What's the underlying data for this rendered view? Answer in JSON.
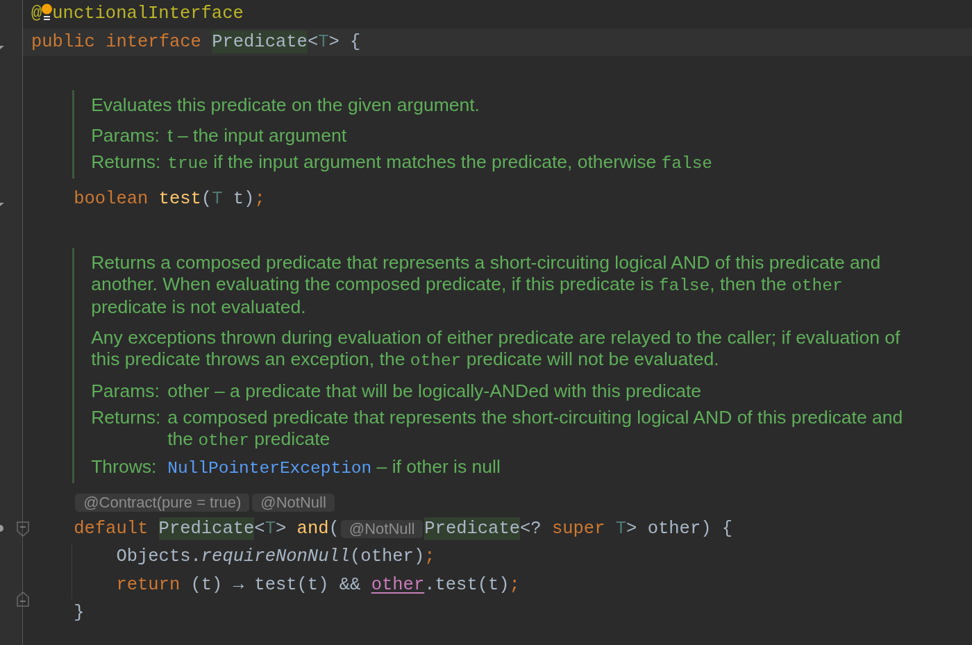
{
  "editor": {
    "lines": [
      {
        "kind": "code",
        "bulb": true,
        "tokens": [
          {
            "text": "@",
            "kind": "annotation"
          },
          {
            "text": "unctionalInterface",
            "kind": "annotation"
          }
        ]
      },
      {
        "kind": "code",
        "current": true,
        "gutter": [
          {
            "kind": "arrow"
          }
        ],
        "tokens": [
          {
            "text": "public ",
            "kind": "keyword"
          },
          {
            "text": "interface ",
            "kind": "keyword"
          },
          {
            "text": "Predicate",
            "kind": "type",
            "highlighted": true
          },
          {
            "text": "<",
            "kind": "type"
          },
          {
            "text": "T",
            "kind": "type-param"
          },
          {
            "text": "> {",
            "kind": "type"
          }
        ],
        "children": [
          {
            "kind": "doc",
            "paragraphs": [
              [
                {
                  "kind": "text",
                  "text": "Evaluates this predicate on the given argument."
                }
              ]
            ],
            "tags": [
              {
                "label": "Params:",
                "segments": [
                  {
                    "kind": "text",
                    "text": "t – the input argument"
                  }
                ]
              },
              {
                "label": "Returns:",
                "segments": [
                  {
                    "kind": "code",
                    "text": "true"
                  },
                  {
                    "kind": "text",
                    "text": " if the input argument matches the predicate, otherwise "
                  },
                  {
                    "kind": "code",
                    "text": "false"
                  }
                ]
              }
            ]
          },
          {
            "kind": "code",
            "gutter": [
              {
                "kind": "arrow"
              }
            ],
            "tokens": [
              {
                "text": "boolean ",
                "kind": "keyword"
              },
              {
                "text": "test",
                "kind": "method"
              },
              {
                "text": "(",
                "kind": "type"
              },
              {
                "text": "T",
                "kind": "type-param"
              },
              {
                "text": " t)",
                "kind": "type"
              },
              {
                "text": ";",
                "kind": "punct"
              }
            ]
          },
          {
            "kind": "doc",
            "paragraphs": [
              [
                {
                  "kind": "text",
                  "text": "Returns a composed predicate that represents a short-circuiting logical AND of this predicate and another. When evaluating the composed predicate, if this predicate is "
                },
                {
                  "kind": "code",
                  "text": "false"
                },
                {
                  "kind": "text",
                  "text": ", then the "
                },
                {
                  "kind": "code",
                  "text": "other"
                },
                {
                  "kind": "text",
                  "text": " predicate is not evaluated."
                }
              ],
              [
                {
                  "kind": "text",
                  "text": "Any exceptions thrown during evaluation of either predicate are relayed to the caller; if evaluation of this predicate throws an exception, the "
                },
                {
                  "kind": "code",
                  "text": "other"
                },
                {
                  "kind": "text",
                  "text": " predicate will not be evaluated."
                }
              ]
            ],
            "tags": [
              {
                "label": "Params:",
                "segments": [
                  {
                    "kind": "text",
                    "text": "other – a predicate that will be logically-ANDed with this predicate"
                  }
                ]
              },
              {
                "label": "Returns:",
                "segments": [
                  {
                    "kind": "text",
                    "text": "a composed predicate that represents the short-circuiting logical AND of this predicate and the "
                  },
                  {
                    "kind": "code",
                    "text": "other"
                  },
                  {
                    "kind": "text",
                    "text": " predicate"
                  }
                ]
              },
              {
                "label": "Throws:",
                "segments": [
                  {
                    "kind": "link",
                    "text": "NullPointerException"
                  },
                  {
                    "kind": "text",
                    "text": " – if other is null"
                  }
                ]
              }
            ]
          },
          {
            "kind": "code",
            "tokens": [
              {
                "text": "@Contract(pure = true)",
                "kind": "hint"
              },
              {
                "text": "@NotNull",
                "kind": "hint"
              }
            ]
          },
          {
            "kind": "code",
            "gutter": [
              {
                "kind": "dot"
              },
              {
                "kind": "fold-start"
              }
            ],
            "tokens": [
              {
                "text": "default ",
                "kind": "keyword"
              },
              {
                "text": "Predicate",
                "kind": "type",
                "highlighted": true
              },
              {
                "text": "<",
                "kind": "type"
              },
              {
                "text": "T",
                "kind": "type-param"
              },
              {
                "text": "> ",
                "kind": "type"
              },
              {
                "text": "and",
                "kind": "method"
              },
              {
                "text": "(",
                "kind": "type"
              },
              {
                "text": "@NotNull",
                "kind": "hint"
              },
              {
                "text": "Predicate",
                "kind": "type",
                "highlighted": true
              },
              {
                "text": "<? ",
                "kind": "type"
              },
              {
                "text": "super ",
                "kind": "keyword"
              },
              {
                "text": "T",
                "kind": "type-param"
              },
              {
                "text": "> other) {",
                "kind": "type"
              }
            ],
            "children": [
              {
                "kind": "code",
                "tokens": [
                  {
                    "text": "Objects.",
                    "kind": "type"
                  },
                  {
                    "text": "requireNonNull",
                    "kind": "static-method"
                  },
                  {
                    "text": "(other)",
                    "kind": "type"
                  },
                  {
                    "text": ";",
                    "kind": "punct"
                  }
                ]
              },
              {
                "kind": "code",
                "tokens": [
                  {
                    "text": "return ",
                    "kind": "keyword"
                  },
                  {
                    "text": "(t) → test(t) && ",
                    "kind": "type"
                  },
                  {
                    "text": "other",
                    "kind": "param-ref"
                  },
                  {
                    "text": ".test(t)",
                    "kind": "type"
                  },
                  {
                    "text": ";",
                    "kind": "punct"
                  }
                ]
              }
            ]
          },
          {
            "kind": "code",
            "gutter": [
              {
                "kind": "fold-end"
              }
            ],
            "tokens": [
              {
                "text": "}",
                "kind": "type"
              }
            ]
          }
        ]
      }
    ]
  }
}
